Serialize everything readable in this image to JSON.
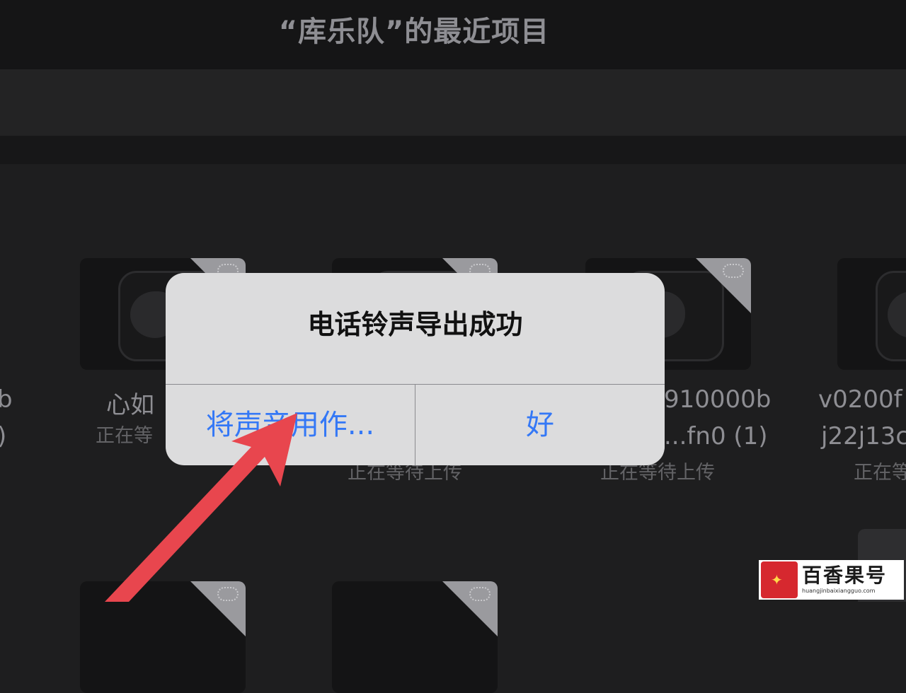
{
  "header": {
    "title": "“库乐队”的最近项目"
  },
  "projects": [
    {
      "line1": "b",
      "line2": ")",
      "status": ""
    },
    {
      "line1": "心如",
      "line2": "",
      "status": "正在等"
    },
    {
      "line1": "",
      "line2": "",
      "status": "正在等待上传"
    },
    {
      "line1": "910000b",
      "line2": "...fn0 (1)",
      "status": "正在等待上传"
    },
    {
      "line1": "v0200f",
      "line2": "j22j13c",
      "status": "正在等"
    }
  ],
  "dialog": {
    "title": "电话铃声导出成功",
    "use_sound_as_label": "将声音用作...",
    "ok_label": "好"
  },
  "icons": {
    "project_icon": "guitar-icon",
    "cloud_icon": "cloud-upload-icon",
    "arrow": "annotation-arrow",
    "watermark_logo": "baixiangguo-logo-icon"
  },
  "watermark": {
    "name": "百香果号",
    "url": "huangjinbaixiangguo.com"
  },
  "colors": {
    "accent": "#3478f6",
    "arrow": "#e8464e",
    "dialog_bg": "#dcdcdd",
    "background": "#1e1e1f"
  }
}
